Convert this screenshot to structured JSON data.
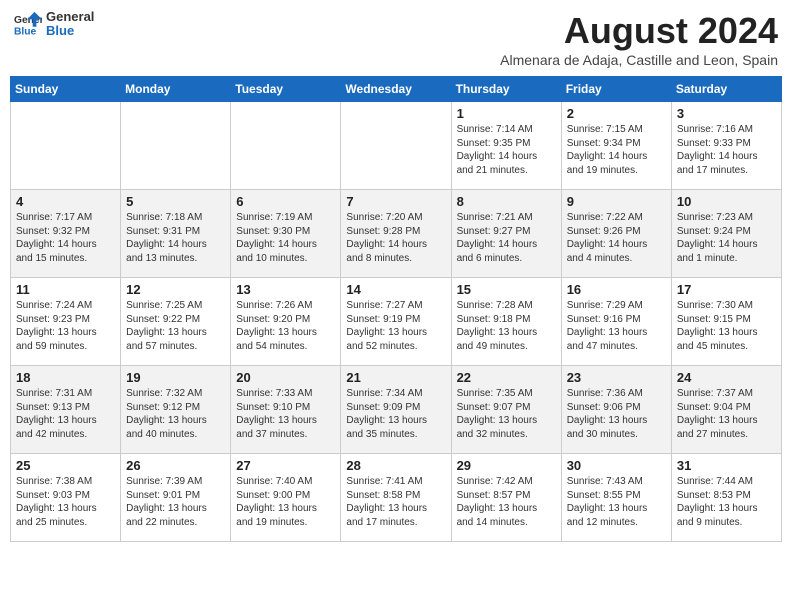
{
  "header": {
    "logo_line1": "General",
    "logo_line2": "Blue",
    "month_year": "August 2024",
    "location": "Almenara de Adaja, Castille and Leon, Spain"
  },
  "weekdays": [
    "Sunday",
    "Monday",
    "Tuesday",
    "Wednesday",
    "Thursday",
    "Friday",
    "Saturday"
  ],
  "weeks": [
    [
      {
        "day": "",
        "info": ""
      },
      {
        "day": "",
        "info": ""
      },
      {
        "day": "",
        "info": ""
      },
      {
        "day": "",
        "info": ""
      },
      {
        "day": "1",
        "info": "Sunrise: 7:14 AM\nSunset: 9:35 PM\nDaylight: 14 hours\nand 21 minutes."
      },
      {
        "day": "2",
        "info": "Sunrise: 7:15 AM\nSunset: 9:34 PM\nDaylight: 14 hours\nand 19 minutes."
      },
      {
        "day": "3",
        "info": "Sunrise: 7:16 AM\nSunset: 9:33 PM\nDaylight: 14 hours\nand 17 minutes."
      }
    ],
    [
      {
        "day": "4",
        "info": "Sunrise: 7:17 AM\nSunset: 9:32 PM\nDaylight: 14 hours\nand 15 minutes."
      },
      {
        "day": "5",
        "info": "Sunrise: 7:18 AM\nSunset: 9:31 PM\nDaylight: 14 hours\nand 13 minutes."
      },
      {
        "day": "6",
        "info": "Sunrise: 7:19 AM\nSunset: 9:30 PM\nDaylight: 14 hours\nand 10 minutes."
      },
      {
        "day": "7",
        "info": "Sunrise: 7:20 AM\nSunset: 9:28 PM\nDaylight: 14 hours\nand 8 minutes."
      },
      {
        "day": "8",
        "info": "Sunrise: 7:21 AM\nSunset: 9:27 PM\nDaylight: 14 hours\nand 6 minutes."
      },
      {
        "day": "9",
        "info": "Sunrise: 7:22 AM\nSunset: 9:26 PM\nDaylight: 14 hours\nand 4 minutes."
      },
      {
        "day": "10",
        "info": "Sunrise: 7:23 AM\nSunset: 9:24 PM\nDaylight: 14 hours\nand 1 minute."
      }
    ],
    [
      {
        "day": "11",
        "info": "Sunrise: 7:24 AM\nSunset: 9:23 PM\nDaylight: 13 hours\nand 59 minutes."
      },
      {
        "day": "12",
        "info": "Sunrise: 7:25 AM\nSunset: 9:22 PM\nDaylight: 13 hours\nand 57 minutes."
      },
      {
        "day": "13",
        "info": "Sunrise: 7:26 AM\nSunset: 9:20 PM\nDaylight: 13 hours\nand 54 minutes."
      },
      {
        "day": "14",
        "info": "Sunrise: 7:27 AM\nSunset: 9:19 PM\nDaylight: 13 hours\nand 52 minutes."
      },
      {
        "day": "15",
        "info": "Sunrise: 7:28 AM\nSunset: 9:18 PM\nDaylight: 13 hours\nand 49 minutes."
      },
      {
        "day": "16",
        "info": "Sunrise: 7:29 AM\nSunset: 9:16 PM\nDaylight: 13 hours\nand 47 minutes."
      },
      {
        "day": "17",
        "info": "Sunrise: 7:30 AM\nSunset: 9:15 PM\nDaylight: 13 hours\nand 45 minutes."
      }
    ],
    [
      {
        "day": "18",
        "info": "Sunrise: 7:31 AM\nSunset: 9:13 PM\nDaylight: 13 hours\nand 42 minutes."
      },
      {
        "day": "19",
        "info": "Sunrise: 7:32 AM\nSunset: 9:12 PM\nDaylight: 13 hours\nand 40 minutes."
      },
      {
        "day": "20",
        "info": "Sunrise: 7:33 AM\nSunset: 9:10 PM\nDaylight: 13 hours\nand 37 minutes."
      },
      {
        "day": "21",
        "info": "Sunrise: 7:34 AM\nSunset: 9:09 PM\nDaylight: 13 hours\nand 35 minutes."
      },
      {
        "day": "22",
        "info": "Sunrise: 7:35 AM\nSunset: 9:07 PM\nDaylight: 13 hours\nand 32 minutes."
      },
      {
        "day": "23",
        "info": "Sunrise: 7:36 AM\nSunset: 9:06 PM\nDaylight: 13 hours\nand 30 minutes."
      },
      {
        "day": "24",
        "info": "Sunrise: 7:37 AM\nSunset: 9:04 PM\nDaylight: 13 hours\nand 27 minutes."
      }
    ],
    [
      {
        "day": "25",
        "info": "Sunrise: 7:38 AM\nSunset: 9:03 PM\nDaylight: 13 hours\nand 25 minutes."
      },
      {
        "day": "26",
        "info": "Sunrise: 7:39 AM\nSunset: 9:01 PM\nDaylight: 13 hours\nand 22 minutes."
      },
      {
        "day": "27",
        "info": "Sunrise: 7:40 AM\nSunset: 9:00 PM\nDaylight: 13 hours\nand 19 minutes."
      },
      {
        "day": "28",
        "info": "Sunrise: 7:41 AM\nSunset: 8:58 PM\nDaylight: 13 hours\nand 17 minutes."
      },
      {
        "day": "29",
        "info": "Sunrise: 7:42 AM\nSunset: 8:57 PM\nDaylight: 13 hours\nand 14 minutes."
      },
      {
        "day": "30",
        "info": "Sunrise: 7:43 AM\nSunset: 8:55 PM\nDaylight: 13 hours\nand 12 minutes."
      },
      {
        "day": "31",
        "info": "Sunrise: 7:44 AM\nSunset: 8:53 PM\nDaylight: 13 hours\nand 9 minutes."
      }
    ]
  ]
}
